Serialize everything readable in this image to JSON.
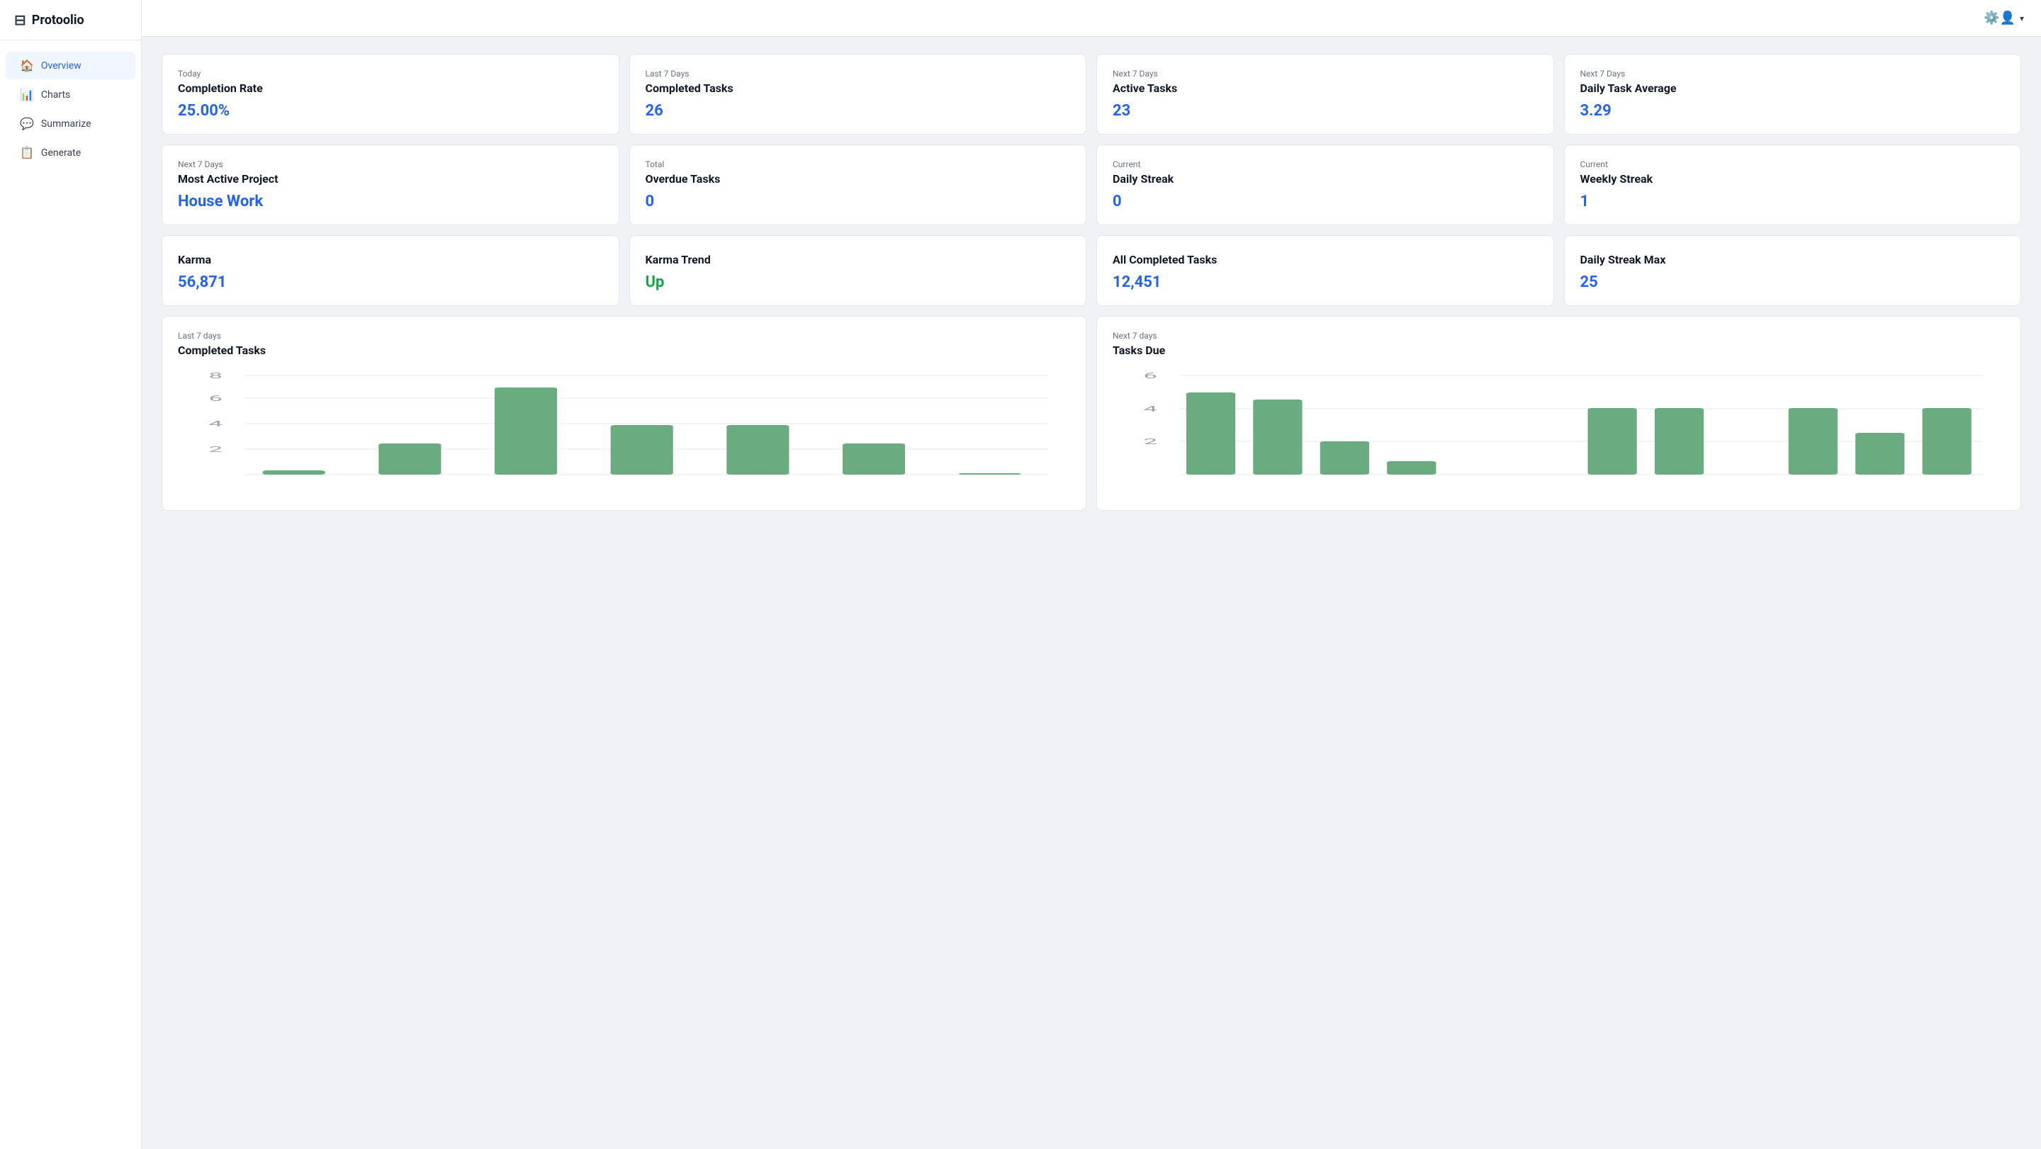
{
  "app": {
    "name": "Protoolio"
  },
  "sidebar": {
    "items": [
      {
        "id": "overview",
        "label": "Overview",
        "icon": "🏠",
        "active": true
      },
      {
        "id": "charts",
        "label": "Charts",
        "icon": "📊",
        "active": false
      },
      {
        "id": "summarize",
        "label": "Summarize",
        "icon": "💬",
        "active": false
      },
      {
        "id": "generate",
        "label": "Generate",
        "icon": "📋",
        "active": false
      }
    ]
  },
  "topbar": {
    "user_icon": "👤",
    "chevron": "▾"
  },
  "stats": [
    {
      "label_top": "Today",
      "title": "Completion Rate",
      "value": "25.00%",
      "value_color": "blue"
    },
    {
      "label_top": "Last 7 Days",
      "title": "Completed Tasks",
      "value": "26",
      "value_color": "blue"
    },
    {
      "label_top": "Next 7 Days",
      "title": "Active Tasks",
      "value": "23",
      "value_color": "blue"
    },
    {
      "label_top": "Next 7 Days",
      "title": "Daily Task Average",
      "value": "3.29",
      "value_color": "blue"
    },
    {
      "label_top": "Next 7 Days",
      "title": "Most Active Project",
      "value": "House Work",
      "value_color": "blue"
    },
    {
      "label_top": "Total",
      "title": "Overdue Tasks",
      "value": "0",
      "value_color": "blue"
    },
    {
      "label_top": "Current",
      "title": "Daily Streak",
      "value": "0",
      "value_color": "blue"
    },
    {
      "label_top": "Current",
      "title": "Weekly Streak",
      "value": "1",
      "value_color": "blue"
    },
    {
      "label_top": "",
      "title": "Karma",
      "value": "56,871",
      "value_color": "blue"
    },
    {
      "label_top": "",
      "title": "Karma Trend",
      "value": "Up",
      "value_color": "green"
    },
    {
      "label_top": "",
      "title": "All Completed Tasks",
      "value": "12,451",
      "value_color": "blue"
    },
    {
      "label_top": "",
      "title": "Daily Streak Max",
      "value": "25",
      "value_color": "blue"
    }
  ],
  "charts": [
    {
      "label_top": "Last 7 days",
      "title": "Completed Tasks",
      "bars": [
        0.3,
        2.5,
        7,
        4,
        4,
        2.5,
        0
      ],
      "y_max": 8,
      "y_labels": [
        "8",
        "6",
        "4",
        "2"
      ]
    },
    {
      "label_top": "Next 7 days",
      "title": "Tasks Due",
      "bars": [
        5,
        4.5,
        2,
        0.8,
        4,
        4,
        4,
        2.5
      ],
      "y_max": 6,
      "y_labels": [
        "6",
        "4",
        "2"
      ]
    }
  ],
  "colors": {
    "accent_blue": "#2563eb",
    "accent_green": "#16a34a",
    "bar_green": "#5a9e6f",
    "bar_light": "#6aab80"
  }
}
